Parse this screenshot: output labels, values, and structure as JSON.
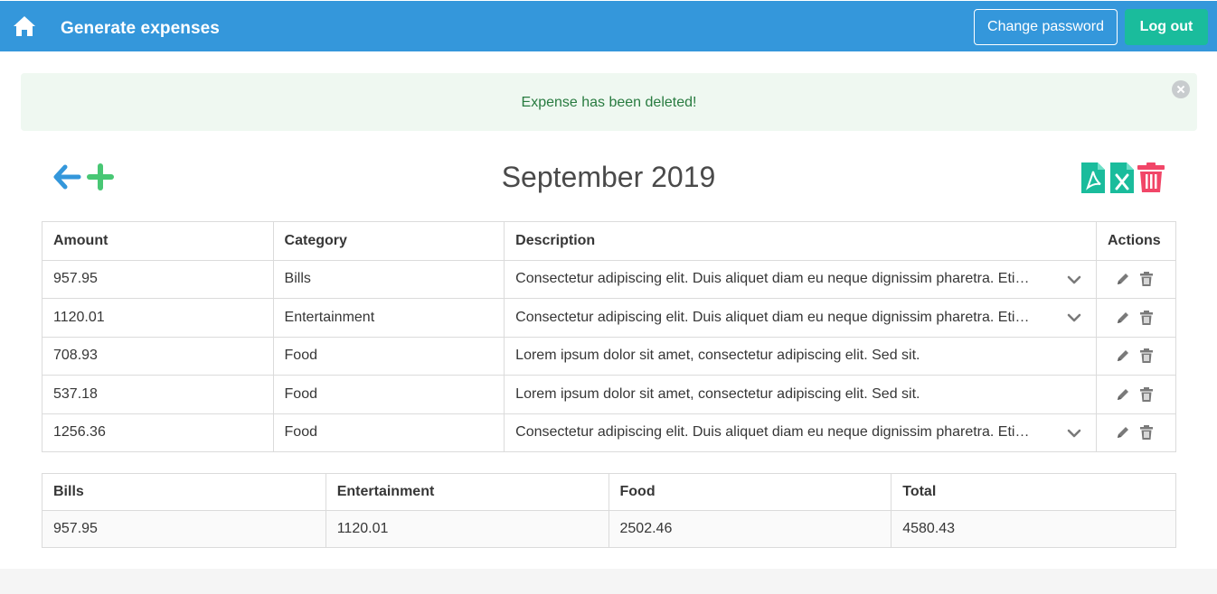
{
  "navbar": {
    "title": "Generate expenses",
    "change_password_label": "Change password",
    "logout_label": "Log out",
    "home_icon": "home-icon",
    "accent_color": "#3497db"
  },
  "notification": {
    "message": "Expense has been deleted!"
  },
  "header": {
    "month_title": "September 2019",
    "left_icons": [
      "arrow-left-icon",
      "plus-icon"
    ],
    "right_icons": [
      "pdf-file-icon",
      "excel-file-icon",
      "trash-icon"
    ]
  },
  "expenses_table": {
    "columns": [
      "Amount",
      "Category",
      "Description",
      "Actions"
    ],
    "rows": [
      {
        "amount": "957.95",
        "category": "Bills",
        "description": "Consectetur adipiscing elit. Duis aliquet diam eu neque dignissim pharetra. Etiam",
        "expandable": true
      },
      {
        "amount": "1120.01",
        "category": "Entertainment",
        "description": "Consectetur adipiscing elit. Duis aliquet diam eu neque dignissim pharetra. Etiam",
        "expandable": true
      },
      {
        "amount": "708.93",
        "category": "Food",
        "description": "Lorem ipsum dolor sit amet, consectetur adipiscing elit. Sed sit.",
        "expandable": false
      },
      {
        "amount": "537.18",
        "category": "Food",
        "description": "Lorem ipsum dolor sit amet, consectetur adipiscing elit. Sed sit.",
        "expandable": false
      },
      {
        "amount": "1256.36",
        "category": "Food",
        "description": "Consectetur adipiscing elit. Duis aliquet diam eu neque dignissim pharetra. Etiam",
        "expandable": true
      }
    ]
  },
  "summary_table": {
    "columns": [
      "Bills",
      "Entertainment",
      "Food",
      "Total"
    ],
    "values": [
      "957.95",
      "1120.01",
      "2502.46",
      "4580.43"
    ]
  }
}
